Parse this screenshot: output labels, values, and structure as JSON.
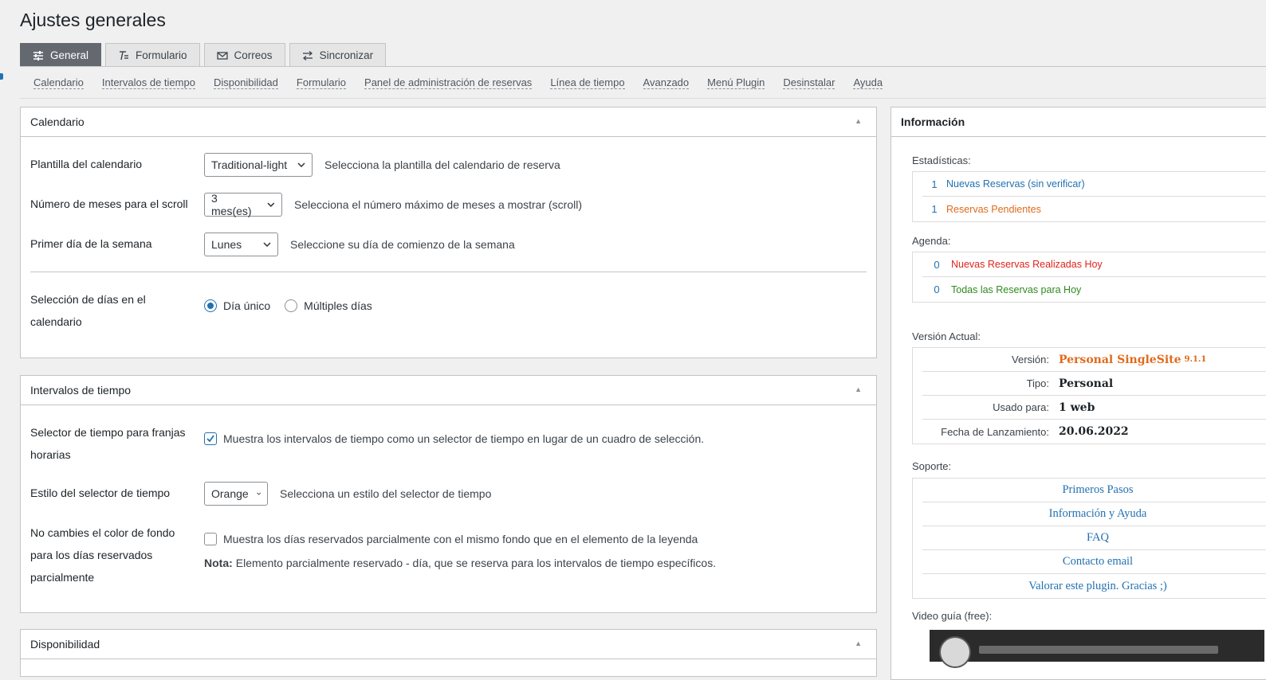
{
  "page": {
    "title": "Ajustes generales"
  },
  "tabs": [
    {
      "label": "General",
      "icon": "sliders-icon",
      "active": true
    },
    {
      "label": "Formulario",
      "icon": "text-format-icon"
    },
    {
      "label": "Correos",
      "icon": "envelope-icon"
    },
    {
      "label": "Sincronizar",
      "icon": "sync-arrows-icon"
    }
  ],
  "subnav": [
    "Calendario",
    "Intervalos de tiempo",
    "Disponibilidad",
    "Formulario",
    "Panel de administración de reservas",
    "Línea de tiempo",
    "Avanzado",
    "Menú Plugin",
    "Desinstalar",
    "Ayuda"
  ],
  "calendario": {
    "title": "Calendario",
    "template_label": "Plantilla del calendario",
    "template_value": "Traditional-light",
    "template_desc": "Selecciona la plantilla del calendario de reserva",
    "months_label": "Número de meses para el scroll",
    "months_value": "3 mes(es)",
    "months_desc": "Selecciona el número máximo de meses a mostrar (scroll)",
    "firstday_label": "Primer día de la semana",
    "firstday_value": "Lunes",
    "firstday_desc": "Seleccione su día de comienzo de la semana",
    "selection_label": "Selección de días en el calendario",
    "selection_opt1": "Día único",
    "selection_opt2": "Múltiples días",
    "selection_selected": "Día único"
  },
  "intervalos": {
    "title": "Intervalos de tiempo",
    "picker_label": "Selector de tiempo para franjas horarias",
    "picker_checked": true,
    "picker_desc": "Muestra los intervalos de tiempo como un selector de tiempo en lugar de un cuadro de selección.",
    "style_label": "Estilo del selector de tiempo",
    "style_value": "Orange",
    "style_desc": "Selecciona un estilo del selector de tiempo",
    "bg_label": "No cambies el color de fondo para los días reservados parcialmente",
    "bg_checked": false,
    "bg_desc": "Muestra los días reservados parcialmente con el mismo fondo que en el elemento de la leyenda",
    "note_bold": "Nota:",
    "note_text": "Elemento parcialmente reservado - día, que se reserva para los intervalos de tiempo específicos."
  },
  "disponibilidad": {
    "title": "Disponibilidad"
  },
  "info": {
    "title": "Información",
    "stats_label": "Estadísticas:",
    "stats": [
      {
        "num": "1",
        "text": "Nuevas Reservas (sin verificar)",
        "color": "#2271b1"
      },
      {
        "num": "1",
        "text": "Reservas Pendientes",
        "color": "#e06a1b"
      }
    ],
    "agenda_label": "Agenda:",
    "agenda": [
      {
        "num": "0",
        "text": "Nuevas Reservas Realizadas Hoy",
        "color": "#e0231b"
      },
      {
        "num": "0",
        "text": "Todas las Reservas para Hoy",
        "color": "#2f8a1f"
      }
    ],
    "version_label": "Versión Actual:",
    "version": {
      "version_key": "Versión:",
      "version_value": "Personal SingleSite",
      "version_number": "9.1.1",
      "type_key": "Tipo:",
      "type_value": "Personal",
      "used_key": "Usado para:",
      "used_value": "1 web",
      "release_key": "Fecha de Lanzamiento:",
      "release_value": "20.06.2022"
    },
    "support_label": "Soporte:",
    "support": [
      "Primeros Pasos",
      "Información y Ayuda",
      "FAQ",
      "Contacto email",
      "Valorar este plugin. Gracias ;)"
    ],
    "video_label": "Video guía (free):"
  }
}
